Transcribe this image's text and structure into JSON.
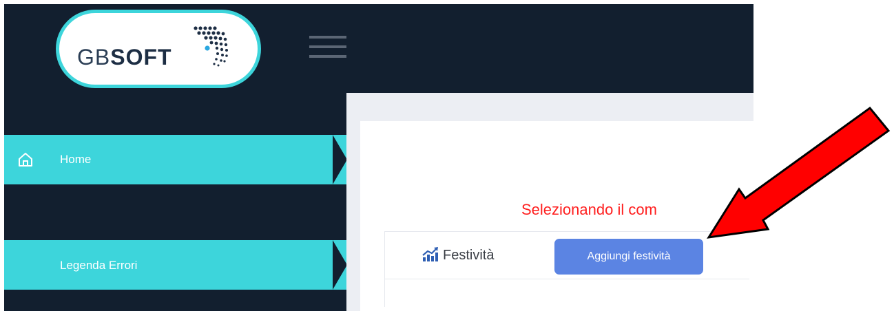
{
  "header": {
    "logo": {
      "text_light": "GB",
      "text_bold": "SOFT",
      "border_color": "#3dd5db"
    },
    "menu_icon": "hamburger-menu-icon"
  },
  "sidebar": {
    "items": [
      {
        "label": "Home",
        "icon": "home-icon",
        "active": true
      },
      {
        "label": "Legenda Errori",
        "icon": null,
        "active": true
      }
    ],
    "background": "#121f2f",
    "accent": "#3dd5db"
  },
  "main": {
    "info_text": "Selezionando il com",
    "info_color": "#ff1f1f",
    "panel": {
      "icon": "chart-icon",
      "title": "Festività",
      "add_button_label": "Aggiungi festività",
      "button_color": "#5b84e3"
    }
  },
  "annotation": {
    "arrow_color": "#ff0000"
  }
}
